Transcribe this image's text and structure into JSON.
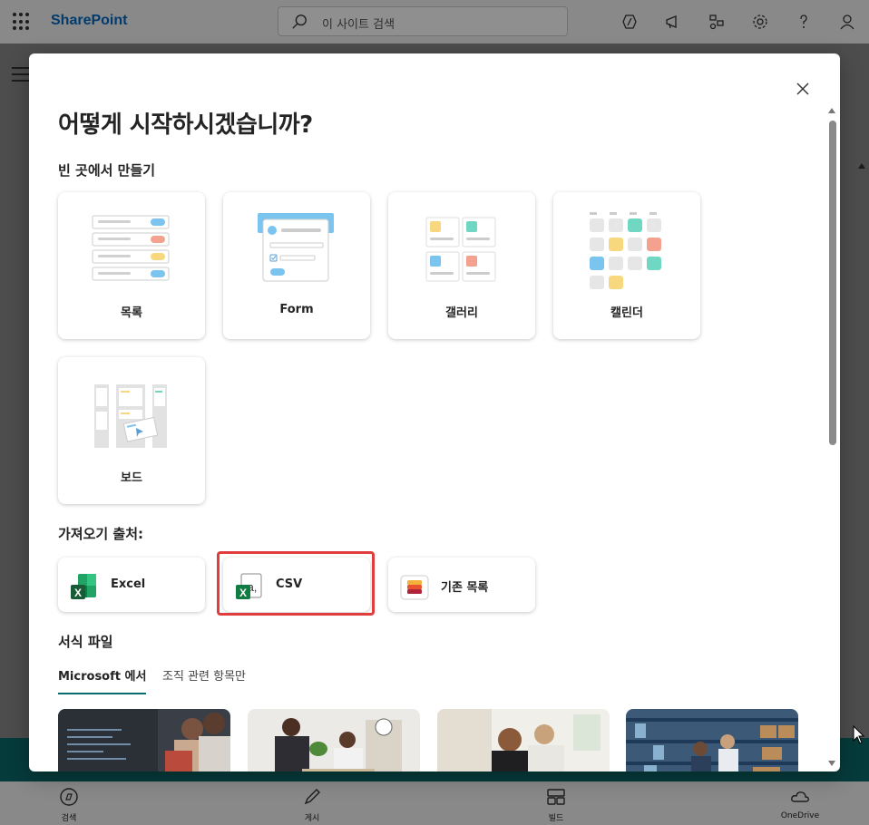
{
  "suitebar": {
    "app_name": "SharePoint",
    "search_placeholder": "이 사이트 검색"
  },
  "bottom_nav": {
    "items": [
      {
        "label": "검색",
        "icon": "compass-icon"
      },
      {
        "label": "게시",
        "icon": "pen-icon"
      },
      {
        "label": "빌드",
        "icon": "layout-icon"
      },
      {
        "label": "OneDrive",
        "icon": "cloud-icon"
      }
    ]
  },
  "dialog": {
    "title": "어떻게 시작하시겠습니까?",
    "blank_section": "빈 곳에서 만들기",
    "blank_tiles": [
      {
        "label": "목록",
        "icon": "list-illustration"
      },
      {
        "label": "Form",
        "icon": "form-illustration"
      },
      {
        "label": "갤러리",
        "icon": "gallery-illustration"
      },
      {
        "label": "캘린더",
        "icon": "calendar-illustration"
      },
      {
        "label": "보드",
        "icon": "board-illustration"
      }
    ],
    "import_section": "가져오기 출처:",
    "import_tiles": [
      {
        "label": "Excel",
        "icon": "excel-icon"
      },
      {
        "label": "CSV",
        "icon": "csv-icon"
      },
      {
        "label": "기존 목록",
        "icon": "lists-icon"
      }
    ],
    "templates_section": "서식 파일",
    "tabs": [
      {
        "label": "Microsoft 에서",
        "active": true
      },
      {
        "label": "조직 관련 항목만",
        "active": false
      }
    ]
  },
  "colors": {
    "brand_blue": "#036ac4",
    "teal": "#0b6a6a",
    "highlight_red": "#e03e3e"
  }
}
